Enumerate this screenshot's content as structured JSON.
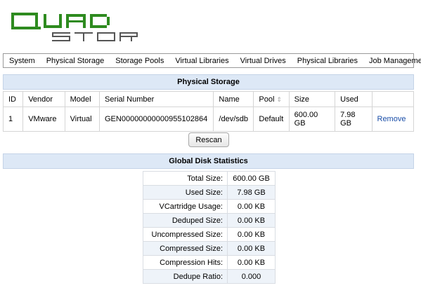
{
  "logo": {
    "line1": "QUAD",
    "line2": "STOR",
    "color": "#2e8b1f"
  },
  "nav": {
    "items": [
      "System",
      "Physical Storage",
      "Storage Pools",
      "Virtual Libraries",
      "Virtual Drives",
      "Physical Libraries",
      "Job Management"
    ]
  },
  "physical_storage": {
    "title": "Physical Storage",
    "columns": [
      "ID",
      "Vendor",
      "Model",
      "Serial Number",
      "Name",
      "Pool",
      "Size",
      "Used",
      ""
    ],
    "rows": [
      {
        "id": "1",
        "vendor": "VMware",
        "model": "Virtual",
        "serial": "GEN00000000000955102864",
        "name": "/dev/sdb",
        "pool": "Default",
        "size": "600.00 GB",
        "used": "7.98 GB",
        "action": "Remove"
      }
    ],
    "rescan_label": "Rescan"
  },
  "global_stats": {
    "title": "Global Disk Statistics",
    "rows": [
      {
        "label": "Total Size:",
        "value": "600.00 GB"
      },
      {
        "label": "Used Size:",
        "value": "7.98 GB"
      },
      {
        "label": "VCartridge Usage:",
        "value": "0.00 KB"
      },
      {
        "label": "Deduped Size:",
        "value": "0.00 KB"
      },
      {
        "label": "Uncompressed Size:",
        "value": "0.00 KB"
      },
      {
        "label": "Compressed Size:",
        "value": "0.00 KB"
      },
      {
        "label": "Compression Hits:",
        "value": "0.00 KB"
      },
      {
        "label": "Dedupe Ratio:",
        "value": "0.000"
      }
    ]
  },
  "colors": {
    "header_bg": "#dde8f6",
    "link": "#1a4ea8",
    "alt_row": "#eef3f9"
  }
}
